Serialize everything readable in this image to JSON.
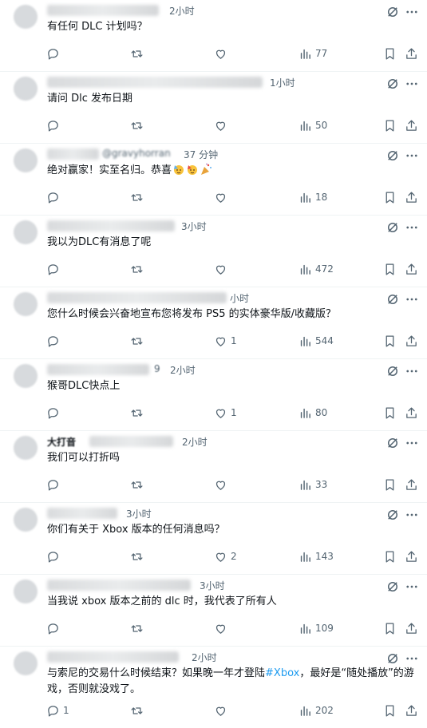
{
  "colors": {
    "text": "#0f1419",
    "muted": "#536471",
    "link": "#1d9bf0",
    "divider": "#eff3f4"
  },
  "icons": {
    "reply": "reply-icon",
    "retweet": "retweet-icon",
    "like": "like-icon",
    "views": "views-icon",
    "bookmark": "bookmark-icon",
    "share": "share-icon",
    "grok": "grok-icon",
    "more": "more-icon"
  },
  "replies": [
    {
      "time": "2小时",
      "text": "有任何 DLC 计划吗？",
      "replies": "",
      "likes": "",
      "views": "77"
    },
    {
      "time": "1小时",
      "text": "请问 Dlc 发布日期",
      "replies": "",
      "likes": "",
      "views": "50"
    },
    {
      "handle_partial": "@gravyhorran",
      "time": "37 分钟",
      "text": "绝对赢家！实至名归。恭喜",
      "replies": "",
      "likes": "",
      "views": "18"
    },
    {
      "time": "3小时",
      "text": "我以为DLC有消息了呢",
      "replies": "",
      "likes": "",
      "views": "472"
    },
    {
      "time": "小时",
      "text": "您什么时候会兴奋地宣布您将发布 PS5 的实体豪华版/收藏版？",
      "replies": "",
      "likes": "1",
      "views": "544"
    },
    {
      "time_prefix": "9",
      "time": "2小时",
      "text": "猴哥DLC快点上",
      "replies": "",
      "likes": "1",
      "views": "80"
    },
    {
      "name_partial": "大打音",
      "time": "2小时",
      "text": "我们可以打折吗",
      "replies": "",
      "likes": "",
      "views": "33"
    },
    {
      "time": "3小时",
      "text": "你们有关于 Xbox 版本的任何消息吗？",
      "replies": "",
      "likes": "2",
      "views": "143"
    },
    {
      "time": "3小时",
      "text": "当我说 xbox 版本之前的 dlc 时，我代表了所有人",
      "replies": "",
      "likes": "",
      "views": "109"
    },
    {
      "time": "2小时",
      "text_before": "与索尼的交易什么时候结束？如果晚一年才登陆",
      "hashtag": "#Xbox",
      "text_after": "，最好是“随处播放”的游戏，否则就没戏了。",
      "replies": "1",
      "likes": "",
      "views": "202"
    }
  ]
}
